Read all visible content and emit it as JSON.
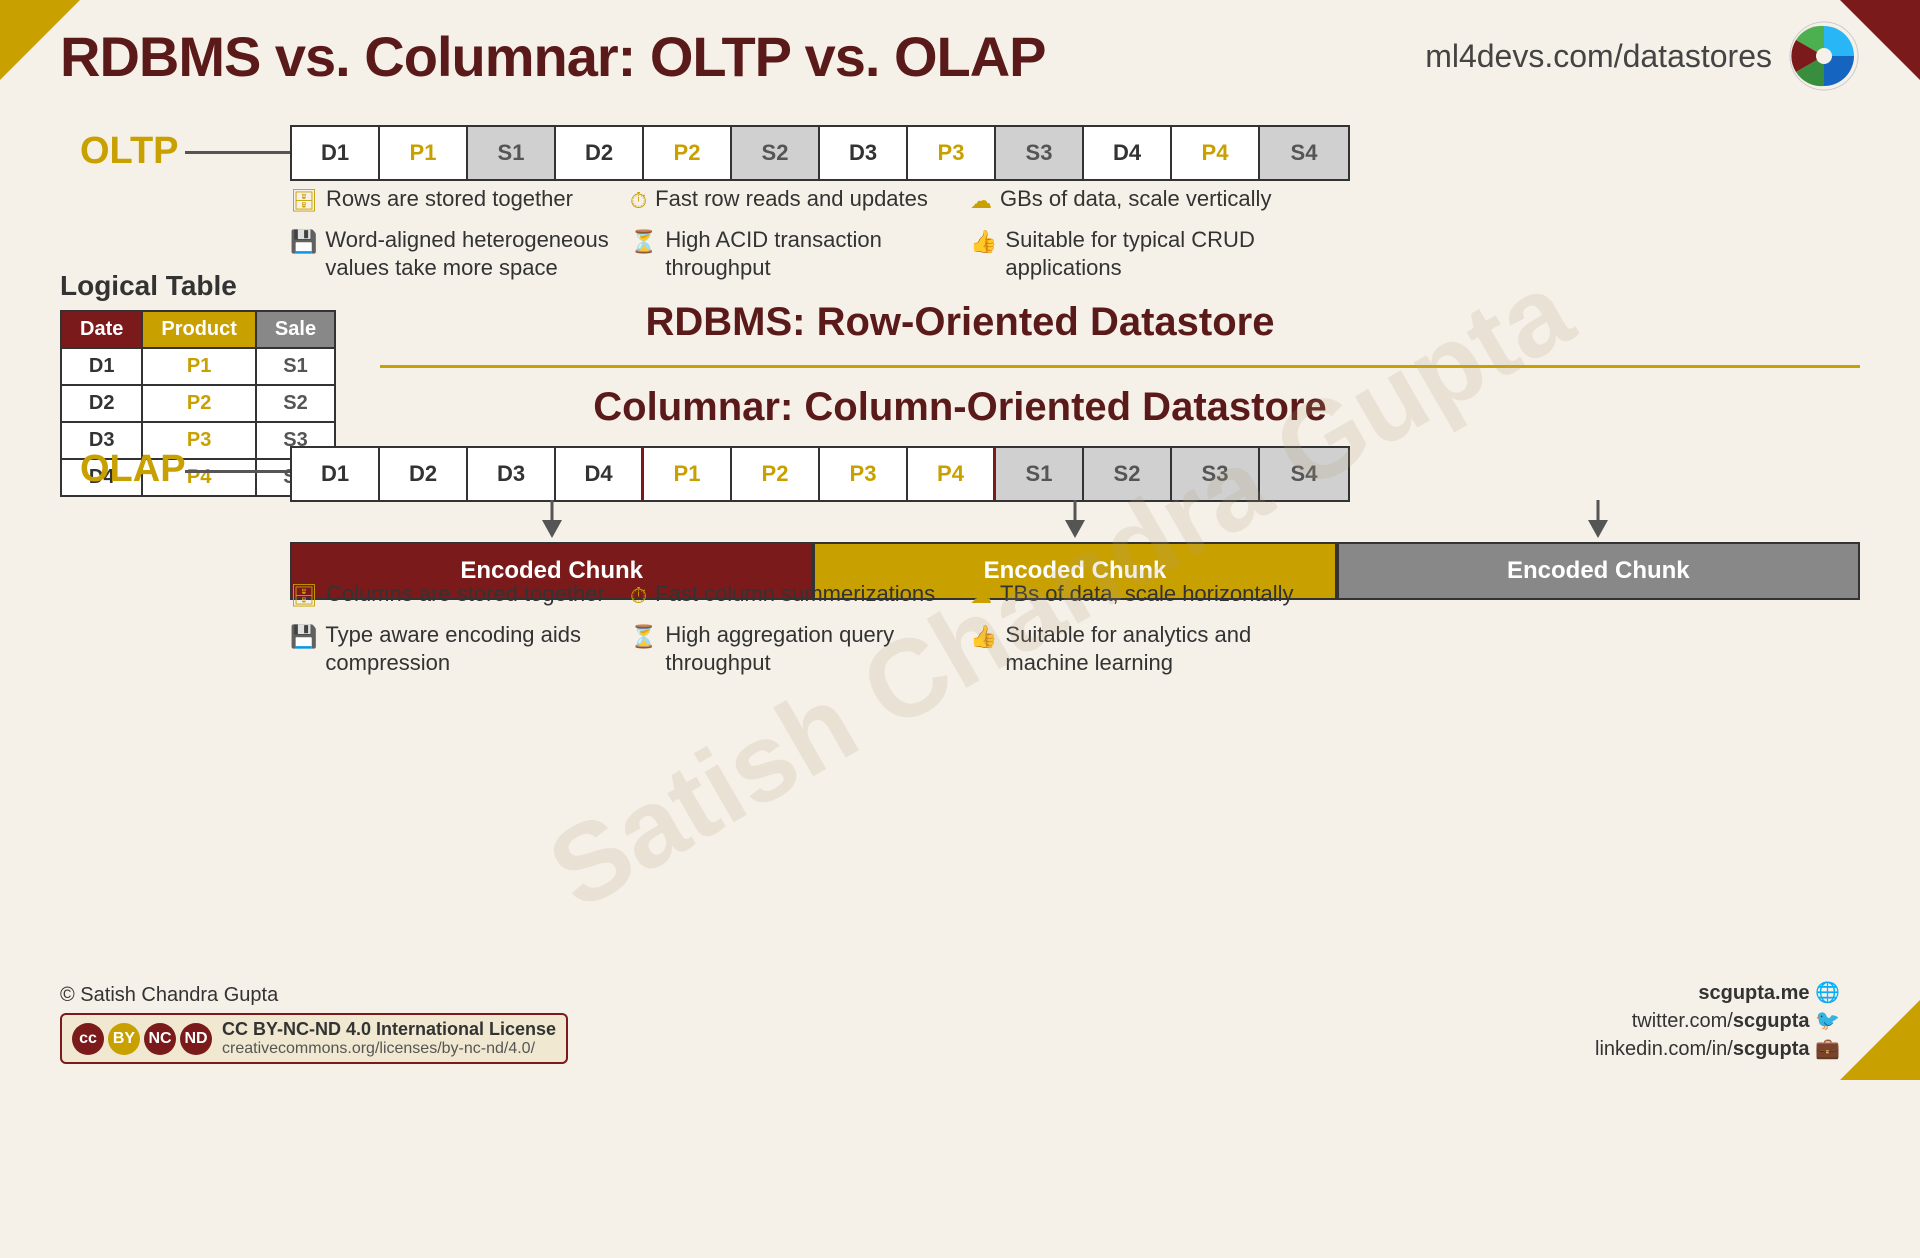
{
  "title": "RDBMS vs. Columnar: OLTP vs. OLAP",
  "website": "ml4devs.com/datastores",
  "watermark": "Satish Chandra Gupta",
  "oltp": {
    "label": "OLTP",
    "row_bar": [
      "D1",
      "P1",
      "S1",
      "D2",
      "P2",
      "S2",
      "D3",
      "P3",
      "S3",
      "D4",
      "P4",
      "S4"
    ],
    "bullet1_icon": "🗄",
    "bullet1": "Rows are stored together",
    "bullet2_icon": "💾",
    "bullet2": "Word-aligned heterogeneous values take more space",
    "bullet3_icon": "⏱",
    "bullet3": "Fast row reads and updates",
    "bullet4_icon": "⏳",
    "bullet4": "High ACID transaction throughput",
    "bullet5_icon": "☁",
    "bullet5": "GBs of data, scale vertically",
    "bullet6_icon": "👍",
    "bullet6": "Suitable for typical CRUD applications"
  },
  "logical_table": {
    "title": "Logical Table",
    "headers": [
      "Date",
      "Product",
      "Sale"
    ],
    "rows": [
      [
        "D1",
        "P1",
        "S1"
      ],
      [
        "D2",
        "P2",
        "S2"
      ],
      [
        "D3",
        "P3",
        "S3"
      ],
      [
        "D4",
        "P4",
        "S4"
      ]
    ]
  },
  "rdbms_title": "RDBMS: Row-Oriented Datastore",
  "columnar_title": "Columnar: Column-Oriented Datastore",
  "olap": {
    "label": "OLAP",
    "col_bar": [
      "D1",
      "D2",
      "D3",
      "D4",
      "P1",
      "P2",
      "P3",
      "P4",
      "S1",
      "S2",
      "S3",
      "S4"
    ],
    "encoded": [
      "Encoded Chunk",
      "Encoded Chunk",
      "Encoded Chunk"
    ],
    "bullet1_icon": "🗄",
    "bullet1": "Columns are stored together",
    "bullet2_icon": "💾",
    "bullet2": "Type aware encoding aids compression",
    "bullet3_icon": "⏱",
    "bullet3": "Fast column summerizations",
    "bullet4_icon": "⏳",
    "bullet4": "High aggregation query throughput",
    "bullet5_icon": "☁",
    "bullet5": "TBs of data, scale horizontally",
    "bullet6_icon": "👍",
    "bullet6": "Suitable for analytics and machine learning"
  },
  "footer": {
    "copyright": "© Satish Chandra Gupta",
    "license": "CC BY-NC-ND 4.0 International License",
    "license_url": "creativecommons.org/licenses/by-nc-nd/4.0/",
    "website1": "scgupta.me",
    "website2": "twitter.com/scgupta",
    "website3": "linkedin.com/in/scgupta"
  }
}
